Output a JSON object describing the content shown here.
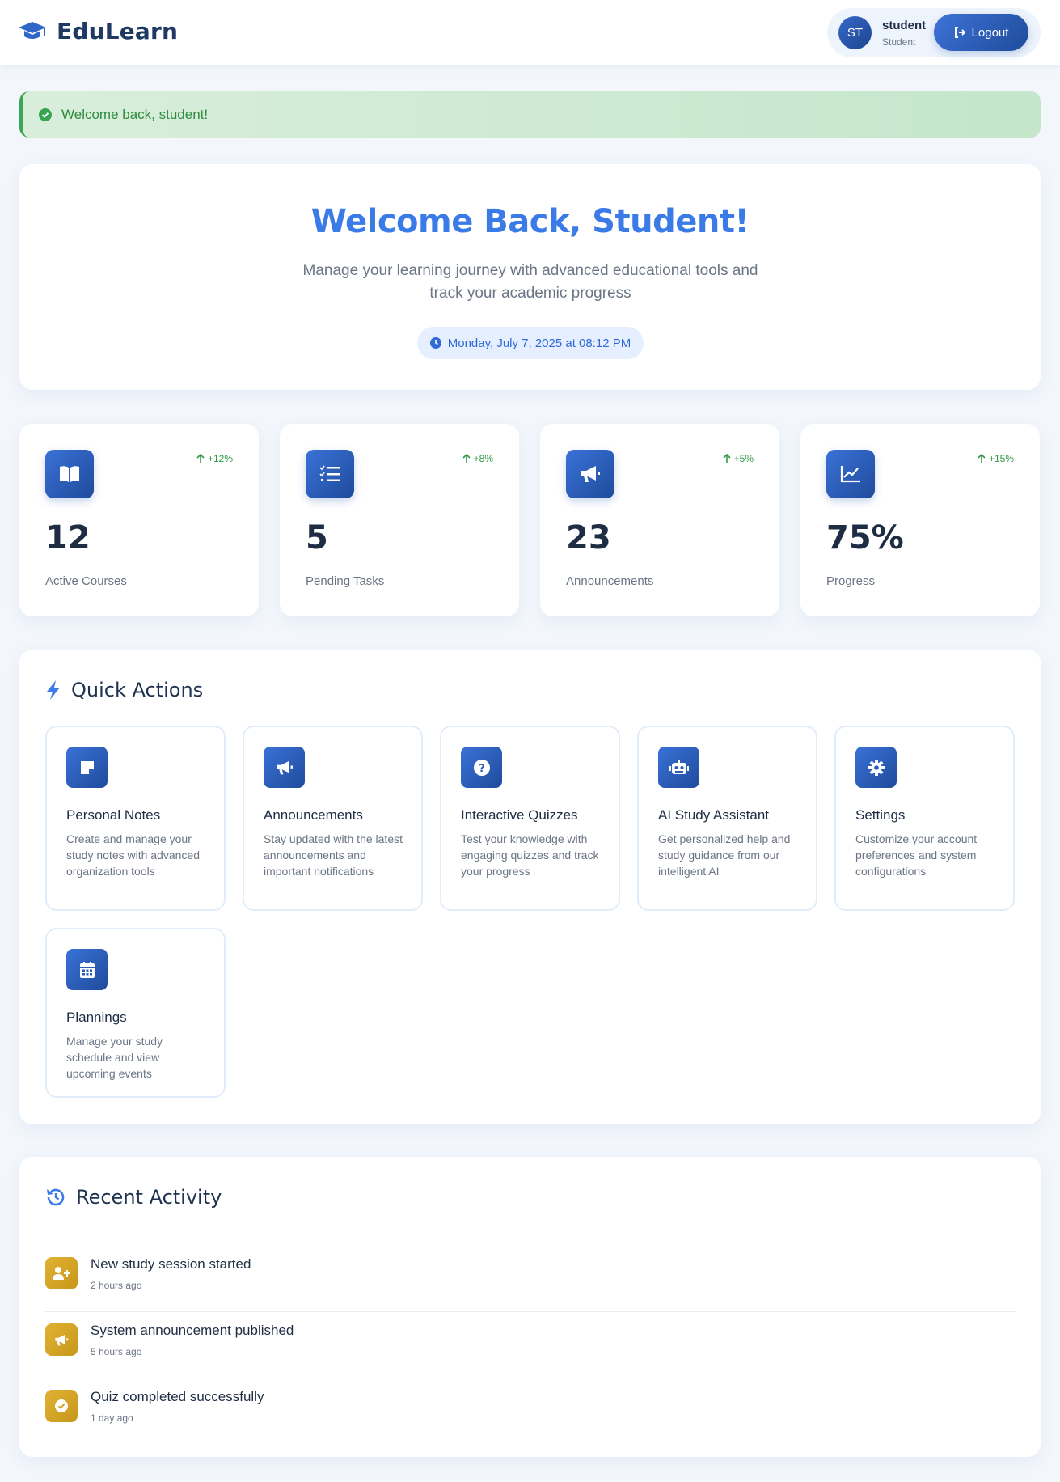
{
  "header": {
    "brand": "EduLearn",
    "brand_icon": "graduation-cap-icon",
    "user": {
      "initials": "ST",
      "name": "student",
      "role": "Student"
    },
    "logout_label": "Logout"
  },
  "alert": {
    "message": "Welcome back, student!"
  },
  "hero": {
    "title": "Welcome Back, Student!",
    "subtitle": "Manage your learning journey with advanced educational tools and track your academic progress",
    "date": "Monday, July 7, 2025 at 08:12 PM"
  },
  "stats": [
    {
      "icon": "book-icon",
      "trend": "+12%",
      "value": "12",
      "label": "Active Courses"
    },
    {
      "icon": "task-list-icon",
      "trend": "+8%",
      "value": "5",
      "label": "Pending Tasks"
    },
    {
      "icon": "megaphone-icon",
      "trend": "+5%",
      "value": "23",
      "label": "Announcements"
    },
    {
      "icon": "chart-line-icon",
      "trend": "+15%",
      "value": "75%",
      "label": "Progress"
    }
  ],
  "quick_actions": {
    "title": "Quick Actions",
    "items": [
      {
        "icon": "sticky-note-icon",
        "title": "Personal Notes",
        "desc": "Create and manage your study notes with advanced organization tools"
      },
      {
        "icon": "megaphone-icon",
        "title": "Announcements",
        "desc": "Stay updated with the latest announcements and important notifications"
      },
      {
        "icon": "question-circle-icon",
        "title": "Interactive Quizzes",
        "desc": "Test your knowledge with engaging quizzes and track your progress"
      },
      {
        "icon": "robot-icon",
        "title": "AI Study Assistant",
        "desc": "Get personalized help and study guidance from our intelligent AI"
      },
      {
        "icon": "gear-icon",
        "title": "Settings",
        "desc": "Customize your account preferences and system configurations"
      },
      {
        "icon": "calendar-icon",
        "title": "Plannings",
        "desc": "Manage your study schedule and view upcoming events"
      }
    ]
  },
  "recent_activity": {
    "title": "Recent Activity",
    "items": [
      {
        "icon": "user-plus-icon",
        "title": "New study session started",
        "time": "2 hours ago"
      },
      {
        "icon": "megaphone-icon",
        "title": "System announcement published",
        "time": "5 hours ago"
      },
      {
        "icon": "check-circle-icon",
        "title": "Quiz completed successfully",
        "time": "1 day ago"
      }
    ]
  },
  "colors": {
    "accent": "#3b7be8",
    "primary_dark": "#1e4b9a",
    "success": "#2f9a45",
    "activity_icon": "#d4a426"
  }
}
